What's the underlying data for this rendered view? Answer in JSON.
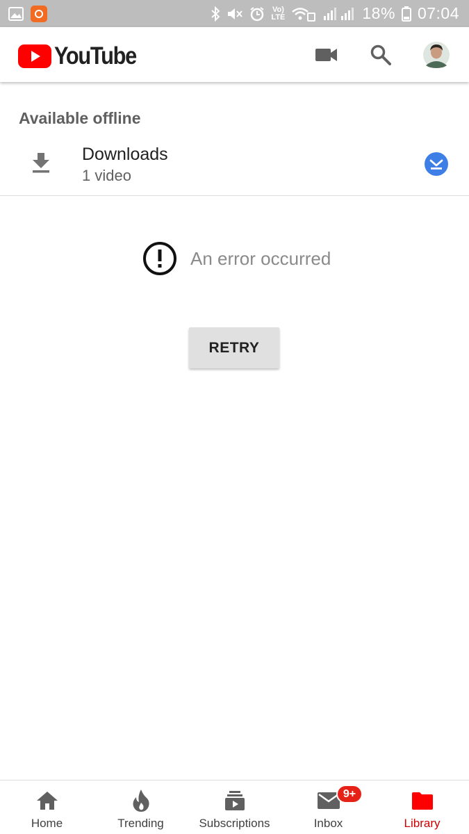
{
  "status_bar": {
    "battery": "18%",
    "time": "07:04",
    "network_label_top": "Vo)",
    "network_label_bottom": "LTE"
  },
  "header": {
    "logo_text": "YouTube",
    "brand_color": "#ff0000",
    "icons": [
      "video-camera-icon",
      "search-icon",
      "avatar"
    ]
  },
  "section": {
    "title": "Available offline"
  },
  "downloads": {
    "title": "Downloads",
    "subtitle": "1 video",
    "check_color": "#3d7fe6"
  },
  "error": {
    "message": "An error occurred",
    "retry_label": "RETRY"
  },
  "bottom_nav": {
    "items": [
      {
        "label": "Home",
        "icon": "home-icon"
      },
      {
        "label": "Trending",
        "icon": "flame-icon"
      },
      {
        "label": "Subscriptions",
        "icon": "subscriptions-icon"
      },
      {
        "label": "Inbox",
        "icon": "mail-icon",
        "badge": "9+"
      },
      {
        "label": "Library",
        "icon": "folder-icon",
        "active": true
      }
    ],
    "active_color": "#cc0000"
  }
}
